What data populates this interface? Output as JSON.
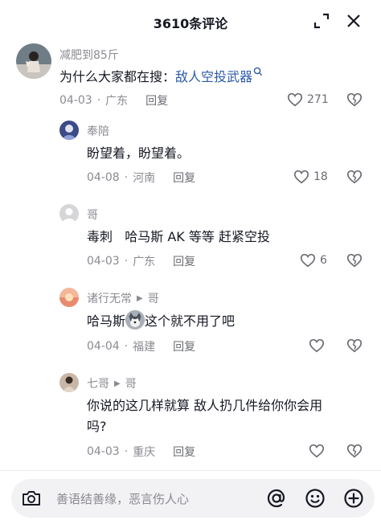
{
  "header": {
    "title": "3610条评论"
  },
  "comments": [
    {
      "author": "减肥到85斤",
      "text_prefix": "为什么大家都在搜：",
      "text_link": "敌人空投武器",
      "date": "04-03",
      "location": "广东",
      "reply_label": "回复",
      "likes": "271"
    },
    {
      "author": "奉陪",
      "text": "盼望着，盼望着。",
      "date": "04-08",
      "location": "河南",
      "reply_label": "回复",
      "likes": "18"
    },
    {
      "author": "哥",
      "text": "毒刺   哈马斯 AK 等等 赶紧空投",
      "date": "04-03",
      "location": "广东",
      "reply_label": "回复",
      "likes": "6"
    },
    {
      "author": "诸行无常",
      "reply_to": "哥",
      "text_before": "哈马斯",
      "text_after": "这个就不用了吧",
      "date": "04-04",
      "location": "福建",
      "reply_label": "回复",
      "likes": ""
    },
    {
      "author": "七哥",
      "reply_to": "哥",
      "text_line1": "你说的这几样就算 敌人扔几件给你你会用",
      "text_line2": "吗?",
      "date": "04-03",
      "location": "重庆",
      "reply_label": "回复",
      "likes": ""
    }
  ],
  "input": {
    "placeholder": "善语结善缘，恶言伤人心"
  },
  "icons": {
    "expand": "expand-icon",
    "close": "close-icon",
    "heart": "heart-icon",
    "dislike": "broken-heart-icon",
    "search": "search-icon",
    "camera": "camera-icon",
    "mention": "at-icon",
    "emoji": "emoji-icon",
    "add": "plus-icon"
  },
  "colors": {
    "link": "#2c5aa8",
    "meta": "#8a8b91",
    "text": "#161823"
  }
}
